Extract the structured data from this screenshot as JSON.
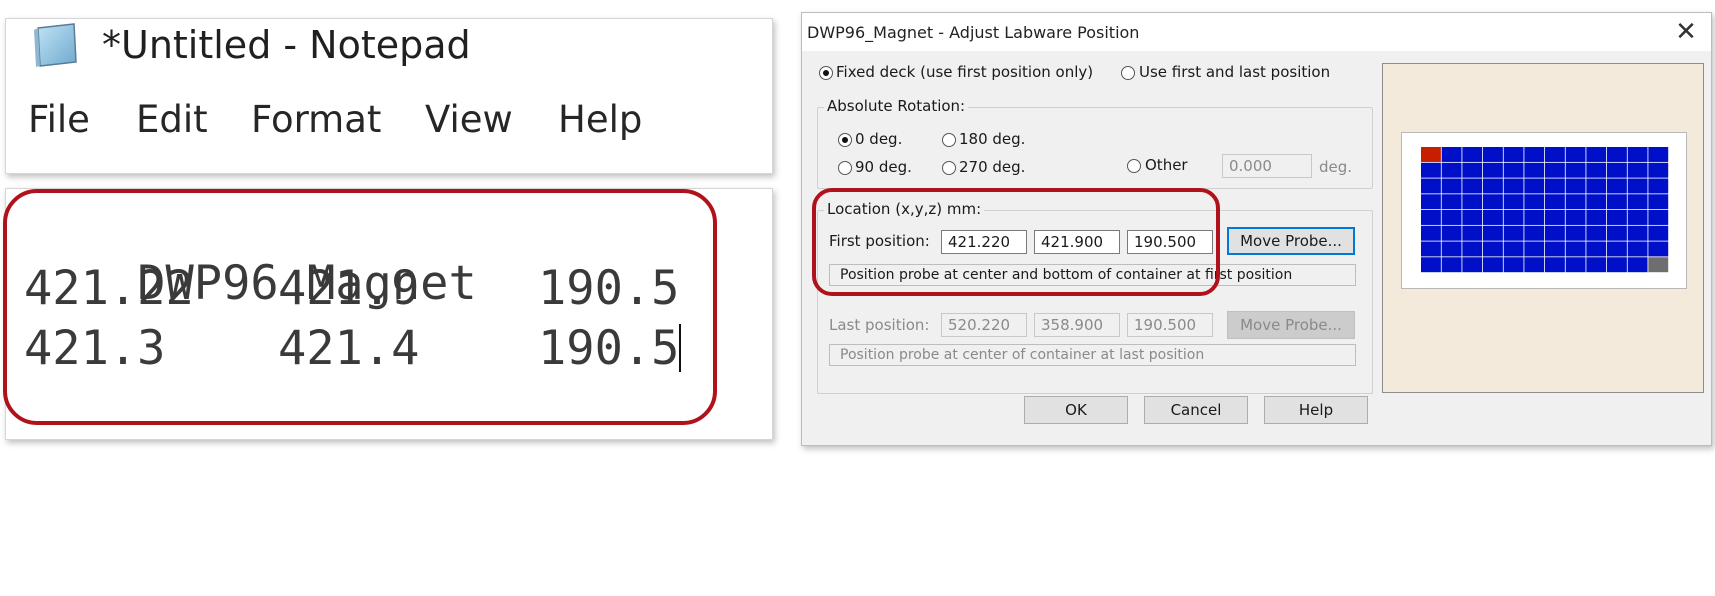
{
  "notepad": {
    "title": "*Untitled - Notepad",
    "menu": [
      "File",
      "Edit",
      "Format",
      "View",
      "Help"
    ],
    "lines": [
      [
        "DWP96 Magnet"
      ],
      [
        "421.22",
        "421.9",
        "190.5"
      ],
      [
        "421.3",
        "421.4",
        "190.5"
      ]
    ]
  },
  "dialog": {
    "title": "DWP96_Magnet - Adjust Labware Position",
    "close_glyph": "✕",
    "mode": {
      "fixed_label": "Fixed deck (use first position only)",
      "first_last_label": "Use first and last position",
      "selected": "fixed"
    },
    "rotation": {
      "group_label": "Absolute Rotation:",
      "options": [
        "0 deg.",
        "180 deg.",
        "90 deg.",
        "270 deg.",
        "Other"
      ],
      "selected": "0 deg.",
      "other_value": "0.000",
      "other_unit": "deg."
    },
    "location": {
      "group_label": "Location (x,y,z) mm:",
      "first_label": "First position:",
      "first_values": [
        "421.220",
        "421.900",
        "190.500"
      ],
      "first_button": "Move Probe...",
      "first_status": "Position probe at center and bottom of container at first position",
      "last_label": "Last position:",
      "last_values": [
        "520.220",
        "358.900",
        "190.500"
      ],
      "last_button": "Move Probe...",
      "last_status": "Position probe at center of container at last position"
    },
    "buttons": {
      "ok": "OK",
      "cancel": "Cancel",
      "help": "Help"
    },
    "plate": {
      "rows": 8,
      "cols": 12,
      "well_color": "#0010c8",
      "first_well_color": "#c81e00",
      "last_well_color": "#6e6e6e"
    }
  }
}
